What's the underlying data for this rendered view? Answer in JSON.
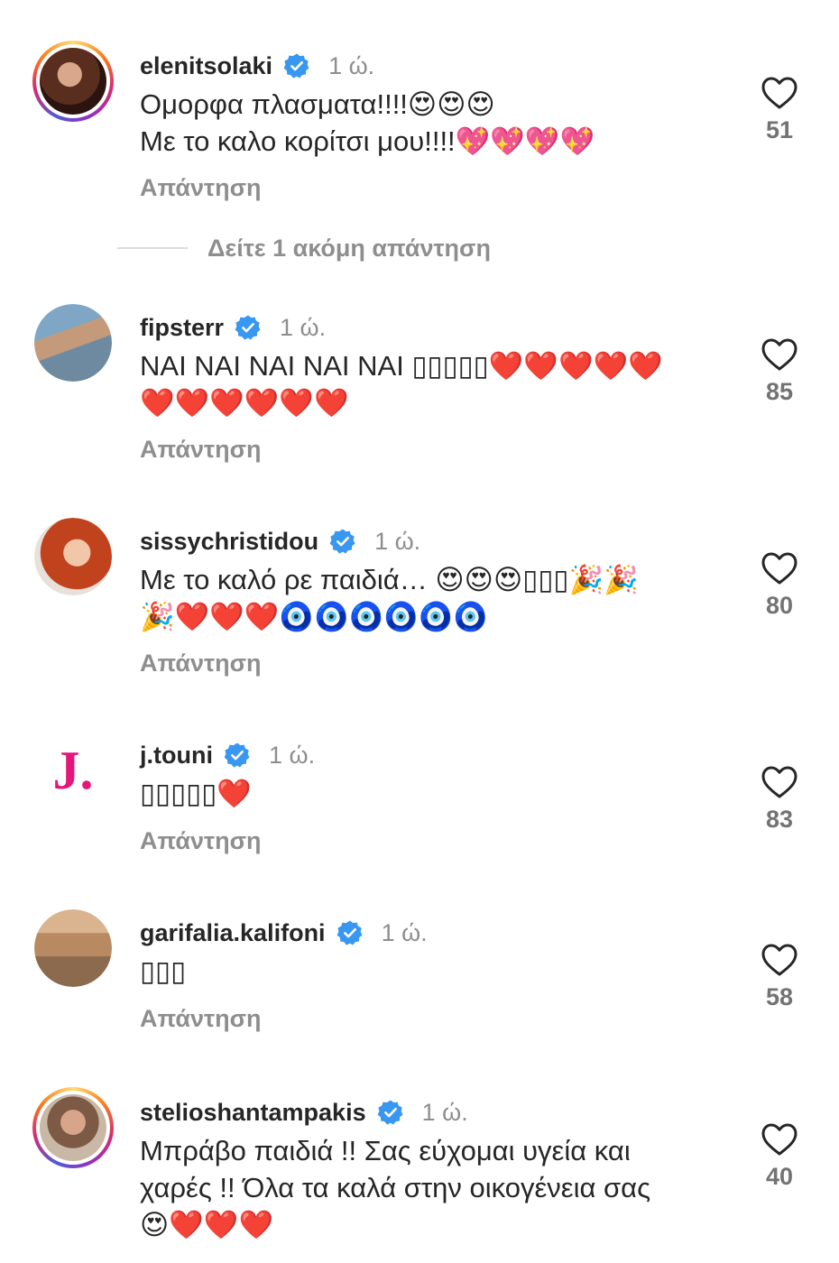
{
  "reply_label": "Απάντηση",
  "colors": {
    "verified": "#3897f0",
    "text": "#262626",
    "muted": "#8e8e8e",
    "count": "#737373"
  },
  "more_replies": {
    "label": "Δείτε 1 ακόμη απάντηση"
  },
  "comments": [
    {
      "username": "elenitsolaki",
      "verified": true,
      "time": "1 ώ.",
      "line1": "Ομορφα πλασματα!!!!😍😍😍",
      "line2": "Με το καλο κορίτσι μου!!!!💖💖💖💖",
      "likes": "51",
      "avatar": "portrait-woman-dark-hair"
    },
    {
      "username": "fipsterr",
      "verified": true,
      "time": "1 ώ.",
      "line1": "ΝΑΙ ΝΑΙ ΝΑΙ ΝΑΙ ΝΑΙ ▯▯▯▯▯❤️❤️❤️❤️❤️",
      "line2": "❤️❤️❤️❤️❤️❤️",
      "likes": "85",
      "avatar": "portrait-man-sunglasses"
    },
    {
      "username": "sissychristidou",
      "verified": true,
      "time": "1 ώ.",
      "line1": "Με το καλό ρε παιδιά… 😍😍😍▯▯▯🎉🎉",
      "line2": "🎉❤️❤️❤️🧿🧿🧿🧿🧿🧿",
      "likes": "80",
      "avatar": "portrait-woman-red-hair"
    },
    {
      "username": "j.touni",
      "verified": true,
      "time": "1 ώ.",
      "line1": "▯▯▯▯▯❤️",
      "line2": "",
      "likes": "83",
      "avatar": "j-logo",
      "logo_text": "J."
    },
    {
      "username": "garifalia.kalifoni",
      "verified": true,
      "time": "1 ώ.",
      "line1": "▯▯▯",
      "line2": "",
      "likes": "58",
      "avatar": "portrait-woman-beach"
    },
    {
      "username": "stelioshantampakis",
      "verified": true,
      "time": "1 ώ.",
      "line1": "Μπράβο παιδιά !! Σας εύχομαι υγεία και",
      "line2": "χαρές !! Όλα τα καλά στην οικογένεια σας",
      "line3": "😍❤️❤️❤️",
      "likes": "40",
      "avatar": "portrait-man-beard"
    }
  ]
}
